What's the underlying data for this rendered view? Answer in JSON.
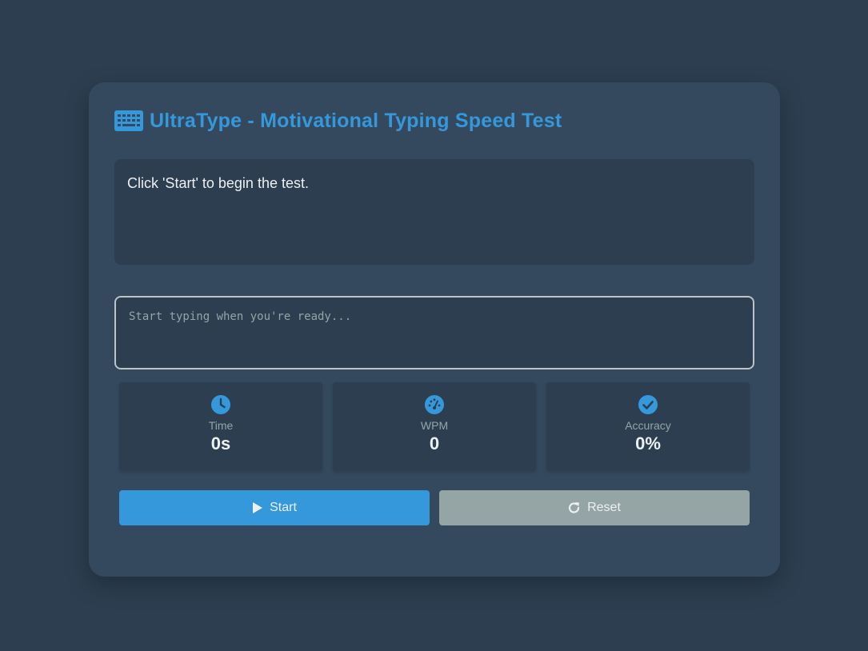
{
  "app": {
    "title": "UltraType - Motivational Typing Speed Test",
    "accent_color": "#3498db",
    "background_color": "#2c3e50",
    "card_color": "#34495e"
  },
  "header": {
    "logo_icon": "keyboard-icon",
    "theme_toggle_icon": "moon-icon"
  },
  "text_display": {
    "message": "Click 'Start' to begin the test."
  },
  "typing_input": {
    "value": "",
    "placeholder": "Start typing when you're ready..."
  },
  "stats": {
    "time": {
      "icon": "clock-icon",
      "label": "Time",
      "value": "0s"
    },
    "wpm": {
      "icon": "speedometer-icon",
      "label": "WPM",
      "value": "0"
    },
    "accuracy": {
      "icon": "check-circle-icon",
      "label": "Accuracy",
      "value": "0%"
    }
  },
  "buttons": {
    "start": {
      "icon": "play-icon",
      "label": "Start",
      "color": "#3498db"
    },
    "reset": {
      "icon": "redo-icon",
      "label": "Reset",
      "color": "#95a5a6"
    }
  }
}
